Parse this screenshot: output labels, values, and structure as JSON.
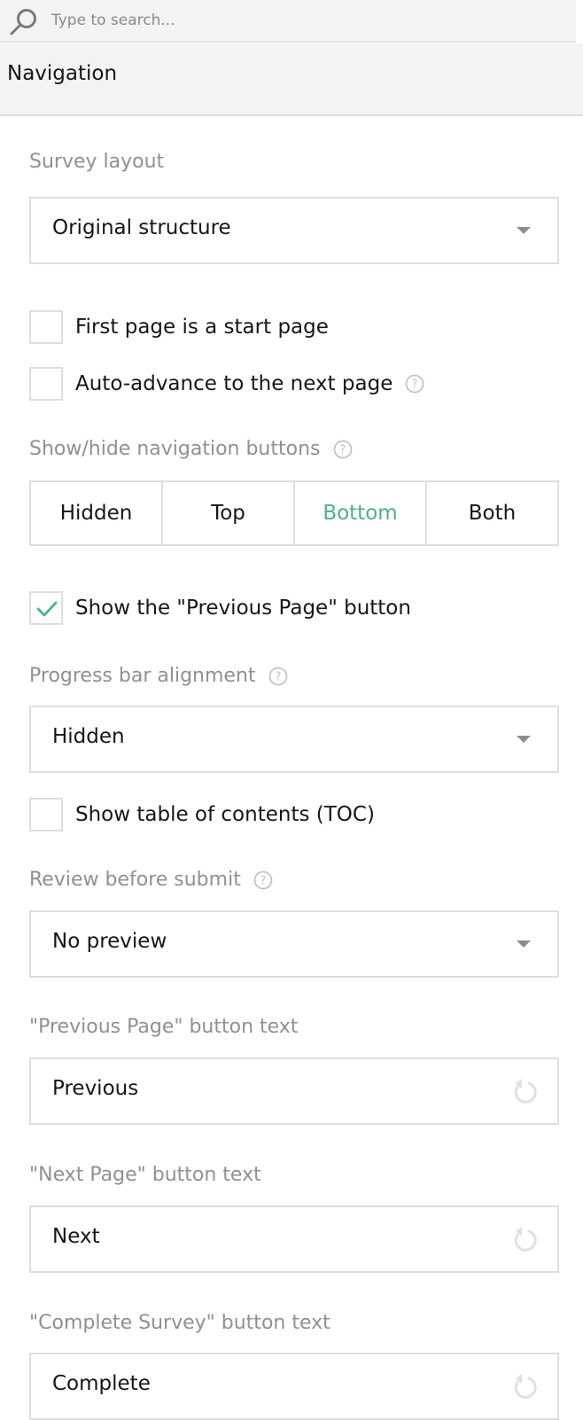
{
  "search": {
    "placeholder": "Type to search..."
  },
  "section": {
    "title": "Navigation"
  },
  "accent_color": "#4fae8a",
  "fields": {
    "survey_layout": {
      "label": "Survey layout",
      "value": "Original structure"
    },
    "first_page_start": {
      "label": "First page is a start page",
      "checked": false
    },
    "auto_advance": {
      "label": "Auto-advance to the next page",
      "checked": false,
      "help_icon": "question-circle-icon"
    },
    "nav_buttons": {
      "label": "Show/hide navigation buttons",
      "help_icon": "question-circle-icon",
      "options": [
        "Hidden",
        "Top",
        "Bottom",
        "Both"
      ],
      "selected": "Bottom"
    },
    "show_prev_button": {
      "label": "Show the \"Previous Page\" button",
      "checked": true
    },
    "progress_bar": {
      "label": "Progress bar alignment",
      "help_icon": "question-circle-icon",
      "value": "Hidden"
    },
    "show_toc": {
      "label": "Show table of contents (TOC)",
      "checked": false
    },
    "review_before_submit": {
      "label": "Review before submit",
      "help_icon": "question-circle-icon",
      "value": "No preview"
    },
    "prev_text": {
      "label": "\"Previous Page\" button text",
      "value": "Previous",
      "reset_icon": "reset-icon"
    },
    "next_text": {
      "label": "\"Next Page\" button text",
      "value": "Next",
      "reset_icon": "reset-icon"
    },
    "complete_text": {
      "label": "\"Complete Survey\" button text",
      "value": "Complete",
      "reset_icon": "reset-icon"
    }
  }
}
